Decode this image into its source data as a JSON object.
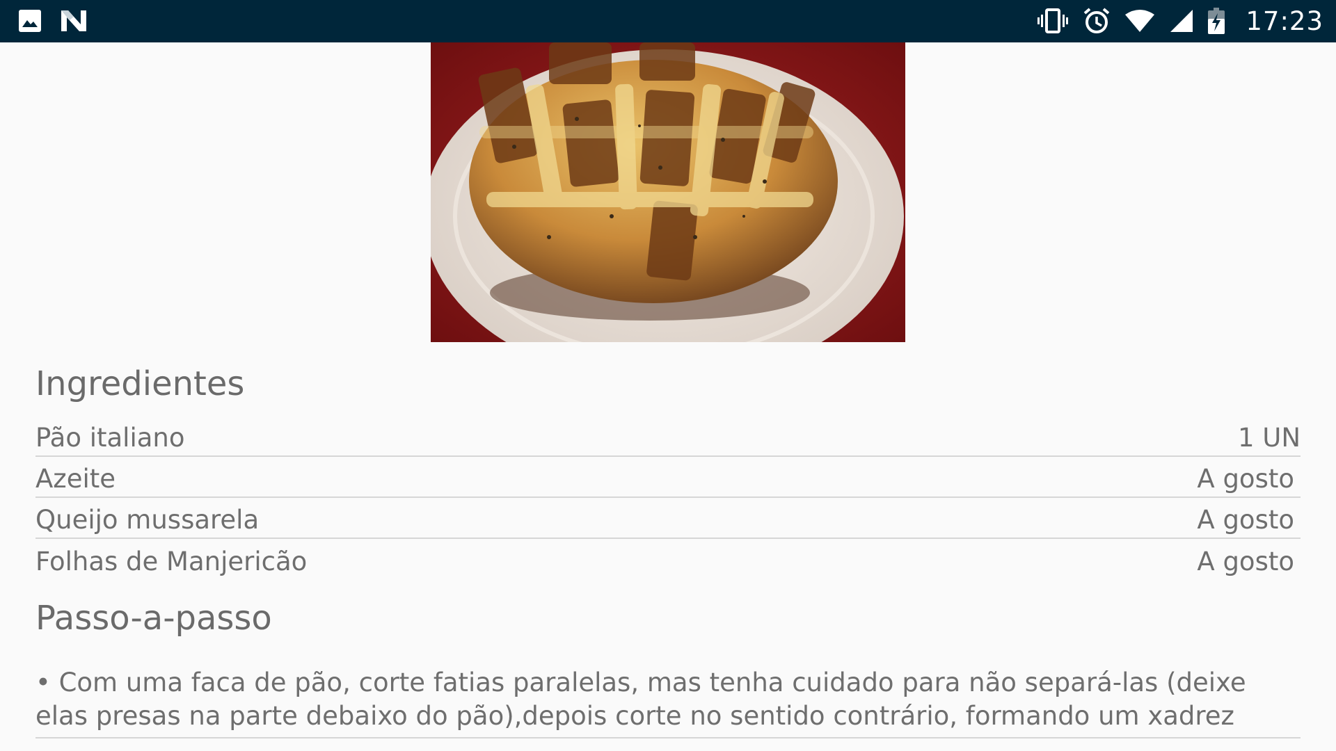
{
  "status_bar": {
    "time": "17:23",
    "left_icons": [
      "gallery-notification-icon",
      "n-logo-notification-icon"
    ],
    "right_icons": [
      "vibrate-icon",
      "alarm-icon",
      "wifi-icon",
      "cell-signal-icon",
      "battery-charging-icon"
    ],
    "background": "#00263a"
  },
  "recipe": {
    "image_name": "pao-italiano-recheado-photo"
  },
  "ingredients": {
    "title": "Ingredientes",
    "items": [
      {
        "name": "Pão italiano",
        "quantity": "1 UN"
      },
      {
        "name": "Azeite",
        "quantity": "A gosto"
      },
      {
        "name": "Queijo mussarela",
        "quantity": "A gosto"
      },
      {
        "name": "Folhas de Manjericão",
        "quantity": "A gosto"
      }
    ]
  },
  "steps": {
    "title": "Passo-a-passo",
    "items": [
      "• Com uma faca de pão, corte fatias paralelas, mas tenha cuidado para não separá-las (deixe elas presas na parte debaixo do pão),depois corte no sentido contrário, formando um xadrez"
    ]
  }
}
